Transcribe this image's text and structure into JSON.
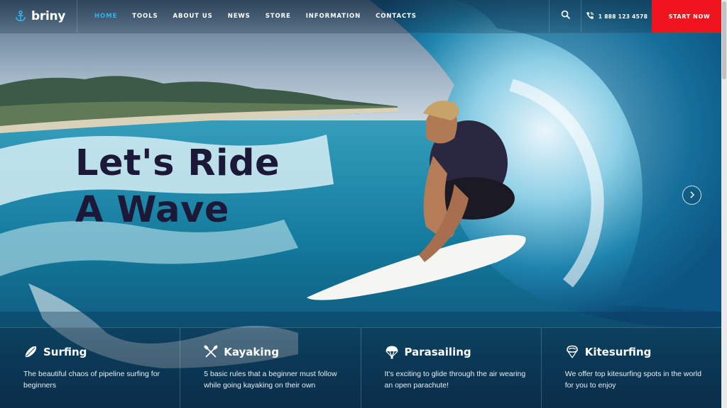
{
  "brand": {
    "name": "briny",
    "icon": "anchor-icon"
  },
  "nav": [
    {
      "label": "HOME",
      "active": true
    },
    {
      "label": "TOOLS"
    },
    {
      "label": "ABOUT US"
    },
    {
      "label": "NEWS"
    },
    {
      "label": "STORE"
    },
    {
      "label": "INFORMATION"
    },
    {
      "label": "CONTACTS"
    }
  ],
  "header": {
    "search_icon": "search-icon",
    "phone": "1 888 123 4578",
    "phone_icon": "phone-icon",
    "cta": "START NOW"
  },
  "hero": {
    "line1": "Let's Ride",
    "line2": "A Wave",
    "next_icon": "chevron-right-icon"
  },
  "features": [
    {
      "title": "Surfing",
      "icon": "surfboard-icon",
      "text": "The beautiful chaos of pipeline surfing for beginners"
    },
    {
      "title": "Kayaking",
      "icon": "paddles-icon",
      "text": "5 basic rules that a beginner must follow while going kayaking on their own"
    },
    {
      "title": "Parasailing",
      "icon": "parachute-icon",
      "text": "It's exciting to glide through the air wearing an open parachute!"
    },
    {
      "title": "Kitesurfing",
      "icon": "kite-icon",
      "text": "We offer top kitesurfing spots in the world for you to enjoy"
    }
  ],
  "colors": {
    "accent": "#2fb3ea",
    "cta": "#f0141e",
    "title": "#1c1838"
  }
}
